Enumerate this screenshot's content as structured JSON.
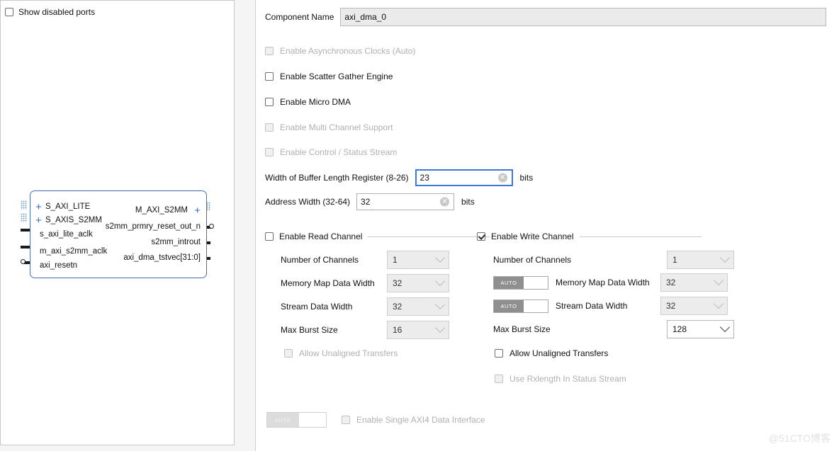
{
  "left_panel": {
    "show_disabled_ports": {
      "label": "Show disabled ports",
      "checked": false
    },
    "diagram": {
      "left_ports": [
        {
          "name": "S_AXI_LITE",
          "type": "bus"
        },
        {
          "name": "S_AXIS_S2MM",
          "type": "bus"
        },
        {
          "name": "s_axi_lite_aclk",
          "type": "clock"
        },
        {
          "name": "m_axi_s2mm_aclk",
          "type": "clock"
        },
        {
          "name": "axi_resetn",
          "type": "reset"
        }
      ],
      "right_ports": [
        {
          "name": "M_AXI_S2MM",
          "type": "bus"
        },
        {
          "name": "s2mm_prmry_reset_out_n",
          "type": "reset"
        },
        {
          "name": "s2mm_introut",
          "type": "signal"
        },
        {
          "name": "axi_dma_tstvec[31:0]",
          "type": "signal"
        }
      ]
    }
  },
  "right_panel": {
    "component_name": {
      "label": "Component Name",
      "value": "axi_dma_0"
    },
    "options": [
      {
        "label": "Enable Asynchronous Clocks (Auto)",
        "checked": false,
        "enabled": false
      },
      {
        "label": "Enable Scatter Gather Engine",
        "checked": false,
        "enabled": true
      },
      {
        "label": "Enable Micro DMA",
        "checked": false,
        "enabled": true
      },
      {
        "label": "Enable Multi Channel Support",
        "checked": false,
        "enabled": false
      },
      {
        "label": "Enable Control / Status Stream",
        "checked": false,
        "enabled": false
      }
    ],
    "width_fields": [
      {
        "label": "Width of Buffer Length Register (8-26)",
        "value": "23",
        "units": "bits",
        "focused": true
      },
      {
        "label": "Address Width (32-64)",
        "value": "32",
        "units": "bits",
        "focused": false
      }
    ],
    "read_channel": {
      "title": "Enable Read Channel",
      "checked": false,
      "params": [
        {
          "label": "Number of Channels",
          "value": "1",
          "enabled": false
        },
        {
          "label": "Memory Map Data Width",
          "value": "32",
          "enabled": false
        },
        {
          "label": "Stream Data Width",
          "value": "32",
          "enabled": false
        },
        {
          "label": "Max Burst Size",
          "value": "16",
          "enabled": false
        }
      ],
      "allow_unaligned": {
        "label": "Allow Unaligned Transfers",
        "checked": false,
        "enabled": false
      }
    },
    "write_channel": {
      "title": "Enable Write Channel",
      "checked": true,
      "params": [
        {
          "label": "Number of Channels",
          "value": "1",
          "enabled": false,
          "auto_toggle": false
        },
        {
          "label": "Memory Map Data Width",
          "value": "32",
          "enabled": false,
          "auto_toggle": true,
          "auto_label": "AUTO"
        },
        {
          "label": "Stream Data Width",
          "value": "32",
          "enabled": false,
          "auto_toggle": true,
          "auto_label": "AUTO"
        },
        {
          "label": "Max Burst Size",
          "value": "128",
          "enabled": true,
          "auto_toggle": false
        }
      ],
      "allow_unaligned": {
        "label": "Allow Unaligned Transfers",
        "checked": false,
        "enabled": true
      },
      "use_rxlength": {
        "label": "Use Rxlength In Status Stream",
        "checked": false,
        "enabled": false
      }
    },
    "single_axi4": {
      "auto_label": "AUTO",
      "label": "Enable Single AXI4 Data Interface",
      "checked": false,
      "enabled": false
    }
  },
  "watermark": "@51CTO博客"
}
